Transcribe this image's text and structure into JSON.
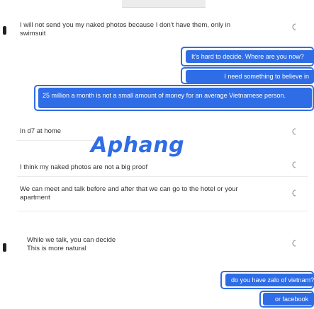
{
  "messages": [
    {
      "text": "I will not send you my naked photos because I don't have them, only in swimsuit"
    },
    {
      "text": "In d7 at home"
    },
    {
      "text": "I think my naked photos are not a big proof"
    },
    {
      "text": "We can meet and talk before and after that we can go to the hotel or your apartment"
    },
    {
      "text": "While we talk, you can decide\nThis is more natural"
    }
  ],
  "options": {
    "o1": "It's hard to decide. Where are you now?",
    "o2": "I need something to believe in",
    "o3": "25 million a month is not a small amount of money for an average Vietnamese person.",
    "o4": "do you have zalo of vietnam?",
    "o5": "or facebook"
  },
  "logo": "Aphang",
  "icons": [
    "reply-icon"
  ]
}
